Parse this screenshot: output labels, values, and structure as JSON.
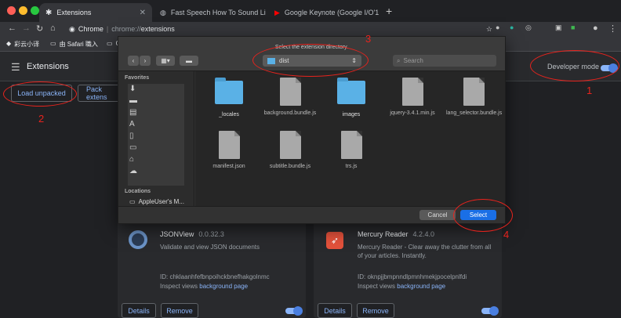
{
  "tabs": [
    {
      "title": "Extensions",
      "active": true
    },
    {
      "title": "Fast Speech  How To Sound Li"
    },
    {
      "title": "Google Keynote (Google I/O'1"
    }
  ],
  "toolbar": {
    "site": "Chrome",
    "url_scheme": "chrome://",
    "url_path": "extensions"
  },
  "bookmarks": [
    "彩云小译",
    "由 Safari 職入",
    "C"
  ],
  "header": {
    "title": "Extensions",
    "dev_mode": "Developer mode",
    "dev_mode_on": true
  },
  "actions": {
    "load_unpacked": "Load unpacked",
    "pack": "Pack extens"
  },
  "dialog": {
    "prompt": "Select the extension directory.",
    "folder": "dist",
    "search_placeholder": "Search",
    "favorites": "Favorites",
    "locations": "Locations",
    "location_item": "AppleUser's M...",
    "cancel": "Cancel",
    "select": "Select",
    "files": [
      {
        "name": "_locales",
        "kind": "folder"
      },
      {
        "name": "background.bundle.js",
        "kind": "js"
      },
      {
        "name": "images",
        "kind": "folder"
      },
      {
        "name": "jquery-3.4.1.min.js",
        "kind": "js"
      },
      {
        "name": "lang_selector.bundle.js",
        "kind": "js"
      },
      {
        "name": "manifest.json",
        "kind": "json"
      },
      {
        "name": "subtitle.bundle.js",
        "kind": "js"
      },
      {
        "name": "trs.js",
        "kind": "js"
      }
    ]
  },
  "cards": [
    {
      "name": "JSONView",
      "version": "0.0.32.3",
      "desc": "Validate and view JSON documents",
      "id": "ID: chklaanhfefbnpoihckbnefhakgolnmc",
      "inspect": "Inspect views",
      "link": "background page",
      "details": "Details",
      "remove": "Remove",
      "enabled": true
    },
    {
      "name": "Mercury Reader",
      "version": "4.2.4.0",
      "desc": "Mercury Reader - Clear away the clutter from all of your articles. Instantly.",
      "id": "ID: oknpjjbmpnndlpmnhmekjpocelpnlfdi",
      "inspect": "Inspect views",
      "link": "background page",
      "details": "Details",
      "remove": "Remove",
      "enabled": true
    }
  ],
  "annotations": [
    "1",
    "2",
    "3",
    "4"
  ],
  "colors": {
    "accent": "#8ab4f8",
    "annotation": "#e8231d",
    "select": "#1a6fe6"
  }
}
